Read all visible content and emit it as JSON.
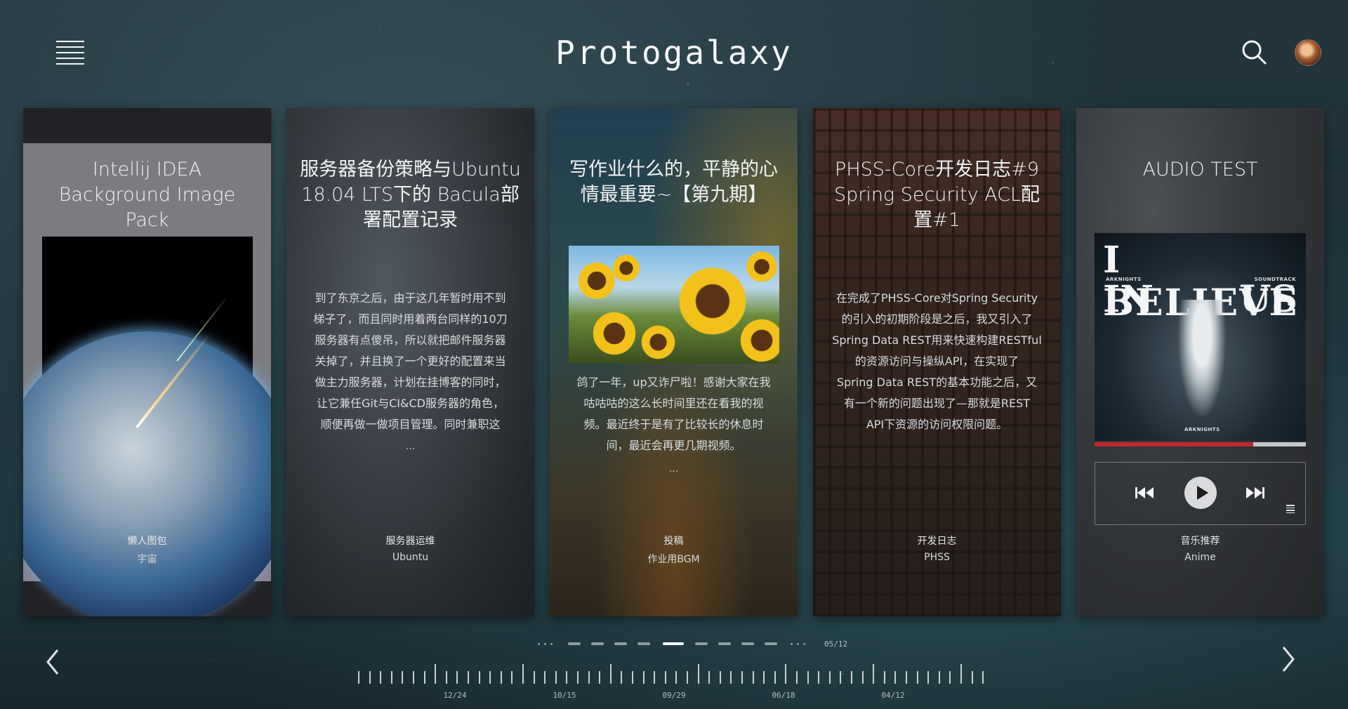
{
  "header": {
    "title": "Protogalaxy"
  },
  "cards": [
    {
      "title": "Intellij IDEA Background Image Pack",
      "category": "懒人图包",
      "tag": "宇宙"
    },
    {
      "title": "服务器备份策略与Ubuntu 18.04 LTS下的 Bacula部署配置记录",
      "excerpt_lines": [
        "到了东京之后，由于这几年暂时用不到",
        "梯子了，而且同时用着两台同样的10刀",
        "服务器有点傻吊，所以就把邮件服务器",
        "关掉了，并且换了一个更好的配置来当",
        "做主力服务器，计划在挂博客的同时，",
        "让它兼任Git与CI&CD服务器的角色，",
        "顺便再做一做项目管理。同时兼职这"
      ],
      "more": "...",
      "category": "服务器运维",
      "tag": "Ubuntu"
    },
    {
      "title": "写作业什么的，平静的心情最重要~【第九期】",
      "excerpt_lines": [
        "鸽了一年，up又诈尸啦！感谢大家在我",
        "咕咕咕的这么长时间里还在看我的视",
        "频。最近终于是有了比较长的休息时",
        "间，最近会再更几期视频。"
      ],
      "more": "...",
      "category": "投稿",
      "tag": "作业用BGM"
    },
    {
      "title": "PHSS-Core开发日志#9 Spring Security ACL配置#1",
      "excerpt_lines": [
        "在完成了PHSS-Core对Spring Security",
        "的引入的初期阶段是之后，我又引入了",
        "Spring Data REST用来快速构建RESTful",
        "的资源访问与操纵API，在实现了",
        "Spring Data REST的基本功能之后，又",
        "有一个新的问题出现了—那就是REST",
        "API下资源的访问权限问题。"
      ],
      "category": "开发日志",
      "tag": "PHSS"
    },
    {
      "title": "AUDIO TEST",
      "album": {
        "line1": "I BELIEVE",
        "line2_left": "IN",
        "line2_right": "US",
        "label_left": "ARKNIGHTS",
        "label_right": "SOUNDTRACK",
        "label_bottom": "ARKNIGHTS"
      },
      "progress": 0.75,
      "progress_color": "#c0282e",
      "category": "音乐推荐",
      "tag": "Anime"
    }
  ],
  "player": {
    "prev_icon": "skip-back-icon",
    "play_icon": "play-icon",
    "next_icon": "skip-forward-icon",
    "playlist_icon": "playlist-icon"
  },
  "pagination": {
    "counter": "05/12",
    "current": 5,
    "total": 12
  },
  "timeline": {
    "labels": [
      "12/24",
      "10/15",
      "09/29",
      "06/18",
      "04/12"
    ]
  },
  "colors": {
    "accent": "#c0282e",
    "text": "#f2f4f5"
  }
}
